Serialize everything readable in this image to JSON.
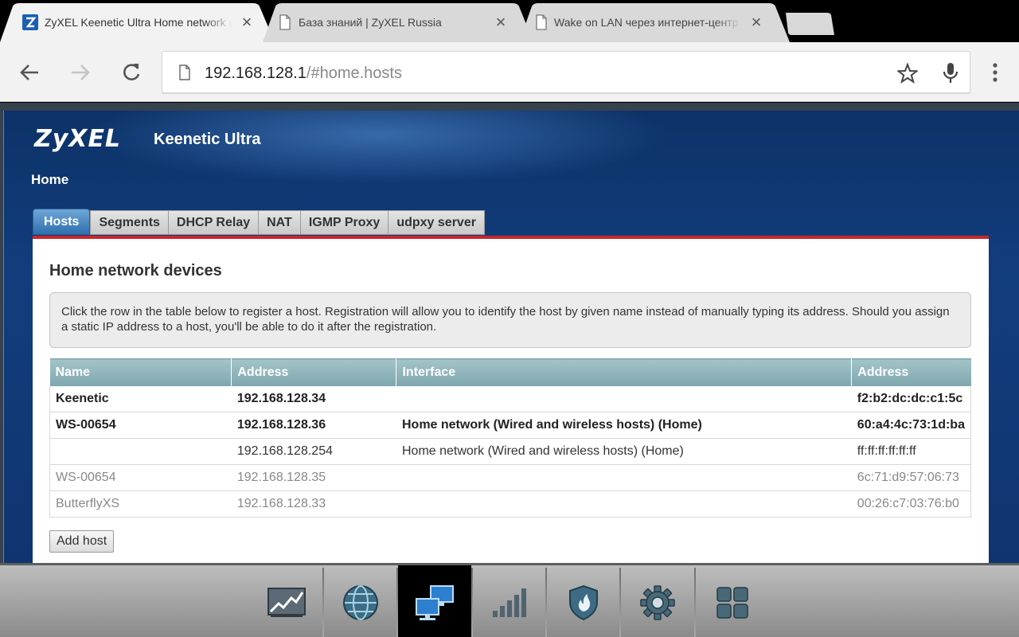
{
  "browser": {
    "tabs": [
      {
        "title": "ZyXEL Keenetic Ultra Home network devices",
        "favicon": "zyxel-z-favicon",
        "active": true
      },
      {
        "title": "База знаний | ZyXEL Russia",
        "favicon": "page-icon",
        "active": false
      },
      {
        "title": "Wake on LAN через интернет-центр серии Keenetic",
        "favicon": "page-icon",
        "active": false
      }
    ],
    "url": {
      "host": "192.168.128.1",
      "path": "/#home.hosts"
    }
  },
  "header": {
    "logo": "ZyXEL",
    "model": "Keenetic Ultra",
    "section": "Home"
  },
  "tabs": [
    {
      "label": "Hosts",
      "active": true
    },
    {
      "label": "Segments"
    },
    {
      "label": "DHCP Relay"
    },
    {
      "label": "NAT"
    },
    {
      "label": "IGMP Proxy"
    },
    {
      "label": "udpxy server"
    }
  ],
  "panel": {
    "title": "Home network devices",
    "info": "Click the row in the table below to register a host. Registration will allow you to identify the host by given name instead of manually typing its address. Should you assign a static IP address to a host, you'll be able to do it after the registration.",
    "columns": [
      "Name",
      "Address",
      "Interface",
      "Address"
    ],
    "rows": [
      {
        "name": "Keenetic",
        "ip": "192.168.128.34",
        "interface": "",
        "mac": "f2:b2:dc:dc:c1:5c",
        "state": "registered"
      },
      {
        "name": "WS-00654",
        "ip": "192.168.128.36",
        "interface": "Home network (Wired and wireless hosts) (Home)",
        "mac": "60:a4:4c:73:1d:ba",
        "state": "registered"
      },
      {
        "name": "",
        "ip": "192.168.128.254",
        "interface": "Home network (Wired and wireless hosts) (Home)",
        "mac": "ff:ff:ff:ff:ff:ff",
        "state": "normal"
      },
      {
        "name": "WS-00654",
        "ip": "192.168.128.35",
        "interface": "",
        "mac": "6c:71:d9:57:06:73",
        "state": "offline"
      },
      {
        "name": "ButterflyXS",
        "ip": "192.168.128.33",
        "interface": "",
        "mac": "00:26:c7:03:76:b0",
        "state": "offline"
      }
    ],
    "add_host_label": "Add host"
  },
  "dock": {
    "items": [
      {
        "icon": "system-monitor-icon"
      },
      {
        "icon": "internet-globe-icon"
      },
      {
        "icon": "home-network-icon",
        "active": true
      },
      {
        "icon": "wifi-signal-icon"
      },
      {
        "icon": "security-shield-icon"
      },
      {
        "icon": "system-settings-icon"
      },
      {
        "icon": "applications-grid-icon"
      }
    ],
    "colors": {
      "accent": "#1e6fb8",
      "tab_active": "#2f6fae",
      "red_rule": "#c8262c"
    }
  }
}
